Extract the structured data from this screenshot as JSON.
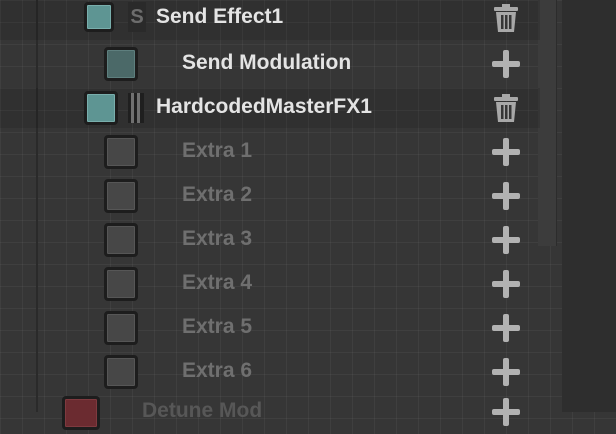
{
  "rows": [
    {
      "label": "Send Effect1",
      "state": "checked",
      "action": "delete"
    },
    {
      "label": "Send Modulation",
      "state": "checked-dim",
      "action": "add"
    },
    {
      "label": "HardcodedMasterFX1",
      "state": "checked",
      "action": "delete"
    },
    {
      "label": "Extra 1",
      "state": "unchecked",
      "action": "add"
    },
    {
      "label": "Extra 2",
      "state": "unchecked",
      "action": "add"
    },
    {
      "label": "Extra 3",
      "state": "unchecked",
      "action": "add"
    },
    {
      "label": "Extra 4",
      "state": "unchecked",
      "action": "add"
    },
    {
      "label": "Extra 5",
      "state": "unchecked",
      "action": "add"
    },
    {
      "label": "Extra 6",
      "state": "unchecked",
      "action": "add"
    },
    {
      "label": "Detune Mod",
      "state": "checked-red",
      "action": "add"
    }
  ],
  "icons": {
    "delete": "trash-icon",
    "add": "plus-icon",
    "drag": "drag-handle-icon"
  },
  "colors": {
    "accent_teal": "#5e9593",
    "accent_red": "#6b2b30",
    "text_bright": "#e4e4e4",
    "text_dim": "#6f6f6f"
  }
}
